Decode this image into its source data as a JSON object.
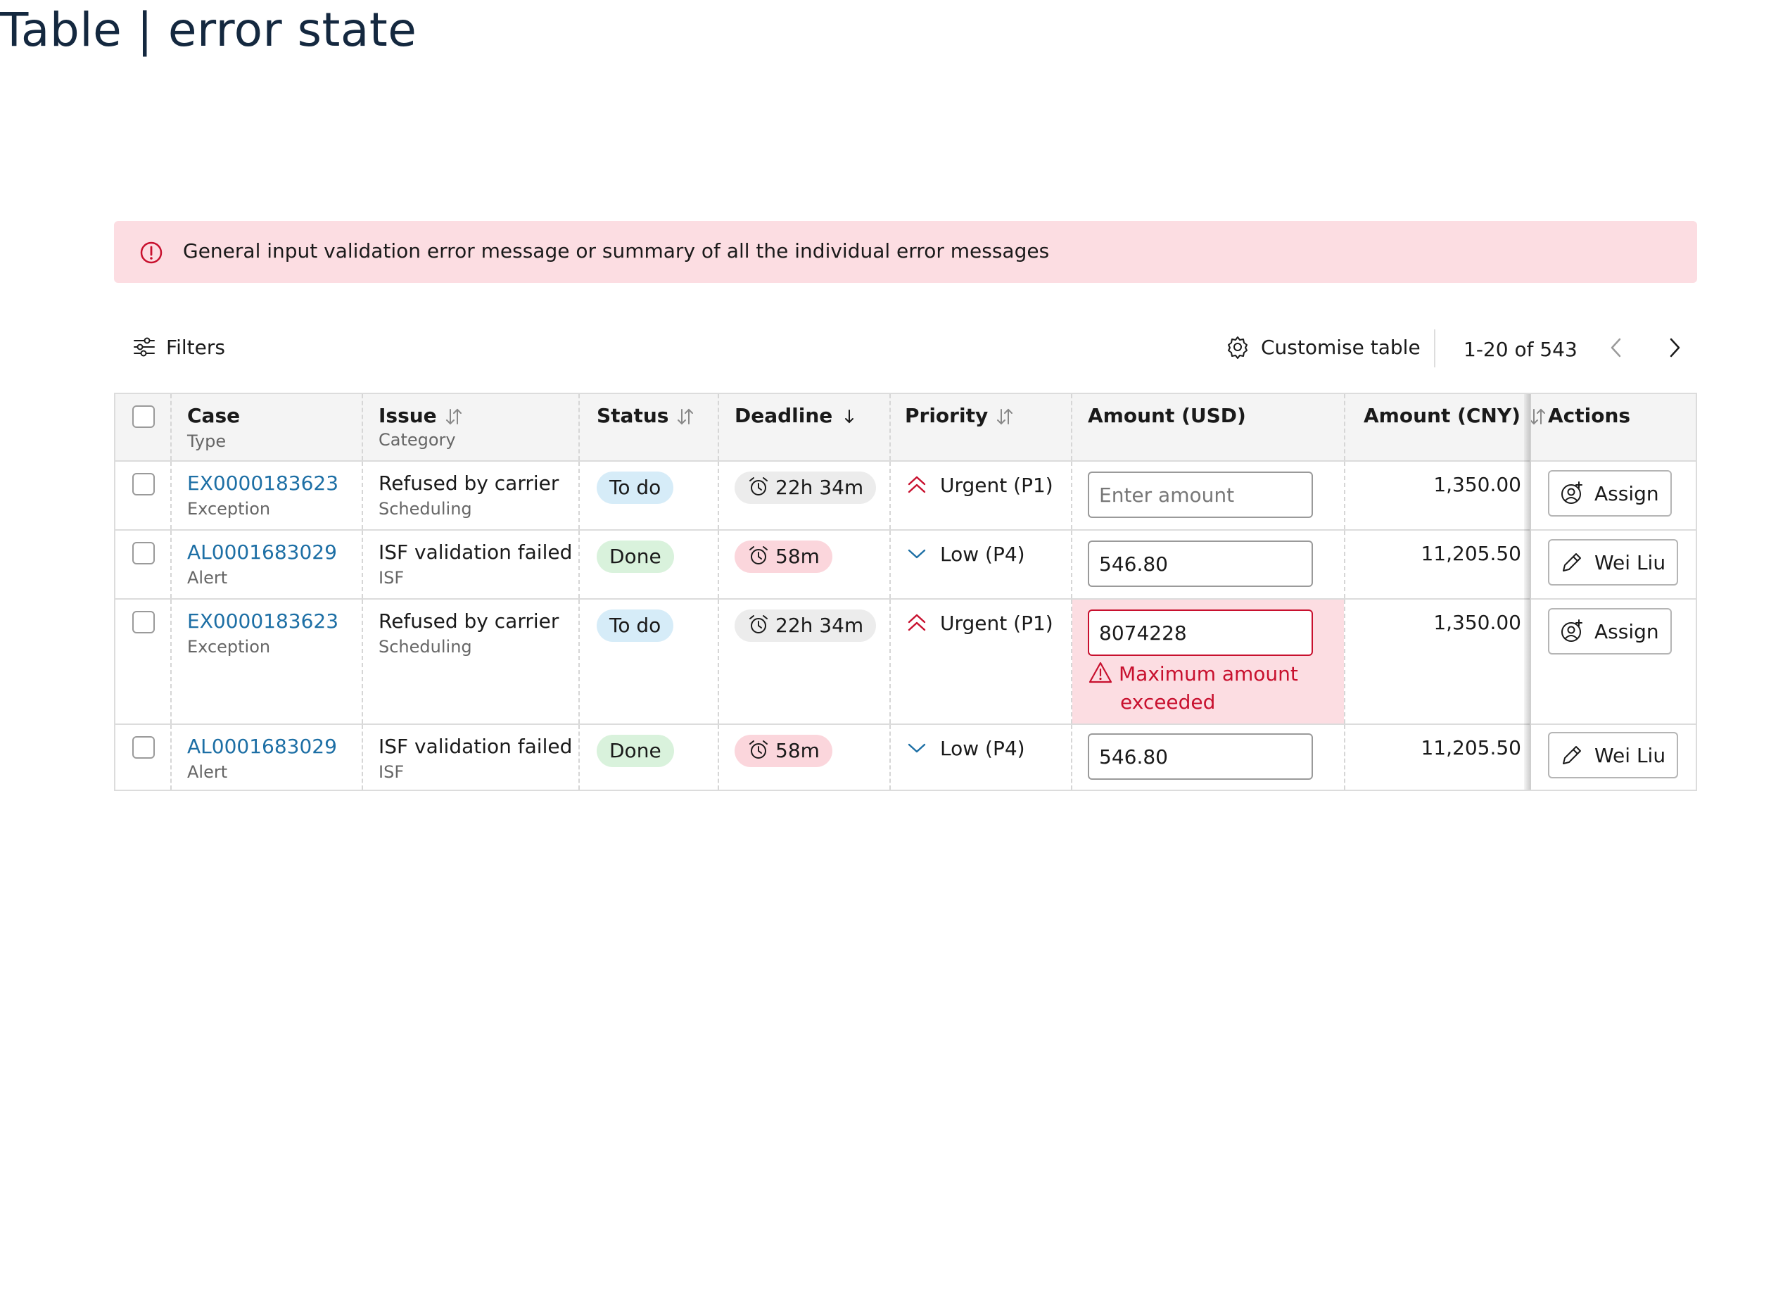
{
  "page": {
    "title": "Table | error state"
  },
  "banner": {
    "icon": "error-circle-icon",
    "message": "General input validation error message or summary of all the individual error messages",
    "bg_color": "#fcdde2"
  },
  "toolbar": {
    "filters_label": "Filters",
    "customise_label": "Customise table",
    "pagination_text": "1-20 of 543"
  },
  "columns": {
    "case": {
      "label": "Case",
      "sub": "Type"
    },
    "issue": {
      "label": "Issue",
      "sub": "Category"
    },
    "status": {
      "label": "Status"
    },
    "deadline": {
      "label": "Deadline"
    },
    "priority": {
      "label": "Priority"
    },
    "amount_usd": {
      "label": "Amount (USD)"
    },
    "amount_cny": {
      "label": "Amount (CNY)"
    },
    "actions": {
      "label": "Actions"
    }
  },
  "rows": [
    {
      "case_id": "EX0000183623",
      "case_type": "Exception",
      "issue": "Refused by carrier",
      "category": "Scheduling",
      "status": "To do",
      "deadline": "22h 34m",
      "priority": "Urgent (P1)",
      "amount_usd_value": "",
      "amount_usd_placeholder": "Enter amount",
      "amount_cny": "1,350.00",
      "action": "Assign"
    },
    {
      "case_id": "AL0001683029",
      "case_type": "Alert",
      "issue": "ISF validation failed",
      "category": "ISF",
      "status": "Done",
      "deadline": "58m",
      "priority": "Low (P4)",
      "amount_usd_value": "546.80",
      "amount_usd_placeholder": "",
      "amount_cny": "11,205.50",
      "action": "Wei Liu"
    },
    {
      "case_id": "EX0000183623",
      "case_type": "Exception",
      "issue": "Refused by carrier",
      "category": "Scheduling",
      "status": "To do",
      "deadline": "22h 34m",
      "priority": "Urgent (P1)",
      "amount_usd_value": "8074228",
      "amount_usd_placeholder": "",
      "amount_cny": "1,350.00",
      "action": "Assign",
      "error": {
        "line1": "Maximum amount",
        "line2": "exceeded"
      }
    },
    {
      "case_id": "AL0001683029",
      "case_type": "Alert",
      "issue": "ISF validation failed",
      "category": "ISF",
      "status": "Done",
      "deadline": "58m",
      "priority": "Low (P4)",
      "amount_usd_value": "546.80",
      "amount_usd_placeholder": "",
      "amount_cny": "11,205.50",
      "action": "Wei Liu"
    }
  ],
  "colors": {
    "link": "#1d6fa5",
    "error": "#c8102e",
    "todo_pill": "#d6ecf8",
    "done_pill": "#d9f2dc",
    "deadline_overdue_pill": "#fbd6dc",
    "deadline_pill": "#ececec"
  }
}
